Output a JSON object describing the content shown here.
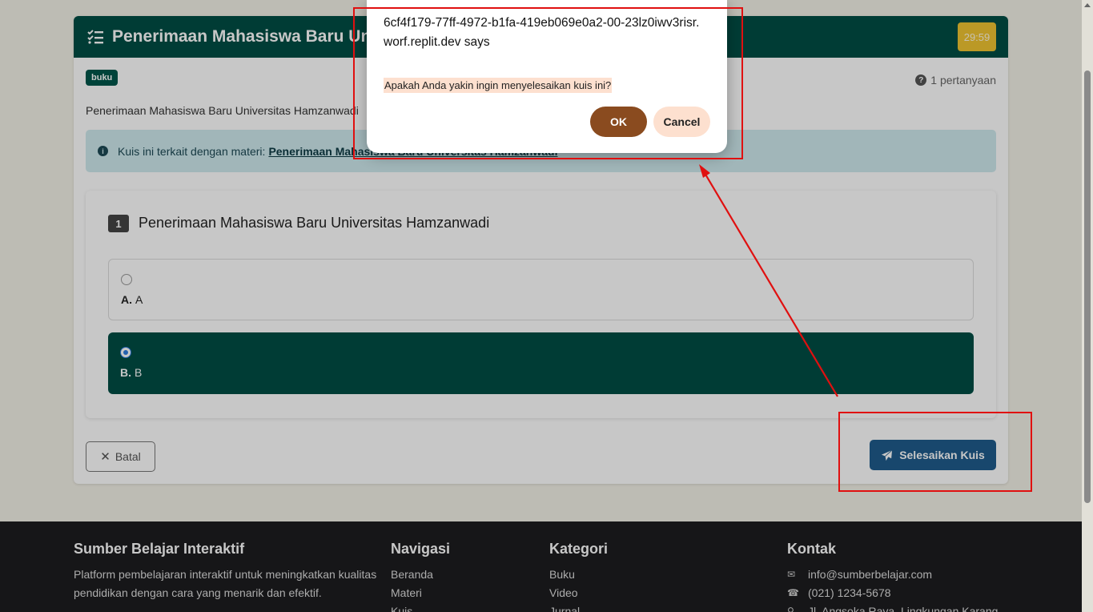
{
  "quiz": {
    "title": "Penerimaan Mahasiswa Baru Uni",
    "timer": "29:59",
    "tag": "buku",
    "question_count": "1 pertanyaan",
    "description": "Penerimaan Mahasiswa Baru Universitas Hamzanwadi",
    "info_prefix": "Kuis ini terkait dengan materi:",
    "info_link": "Penerimaan Mahasiswa Baru Universitas Hamzanwadi",
    "question": {
      "number": "1",
      "text": "Penerimaan Mahasiswa Baru Universitas Hamzanwadi",
      "options": [
        {
          "letter": "A.",
          "text": "A",
          "selected": false
        },
        {
          "letter": "B.",
          "text": "B",
          "selected": true
        }
      ]
    },
    "cancel_label": "Batal",
    "finish_label": "Selesaikan Kuis"
  },
  "footer": {
    "brand": {
      "title": "Sumber Belajar Interaktif",
      "text": "Platform pembelajaran interaktif untuk meningkatkan kualitas pendidikan dengan cara yang menarik dan efektif."
    },
    "nav": {
      "title": "Navigasi",
      "items": [
        "Beranda",
        "Materi",
        "Kuis"
      ]
    },
    "categories": {
      "title": "Kategori",
      "items": [
        "Buku",
        "Video",
        "Jurnal"
      ]
    },
    "contact": {
      "title": "Kontak",
      "email": "info@sumberbelajar.com",
      "phone": "(021) 1234-5678",
      "address": "Jl. Angsoka Raya, Lingkungan Karang"
    }
  },
  "dialog": {
    "origin": "6cf4f179-77ff-4972-b1fa-419eb069e0a2-00-23lz0iwv3risr.worf.replit.dev says",
    "message": "Apakah Anda yakin ingin menyelesaikan kuis ini?",
    "ok_label": "OK",
    "cancel_label": "Cancel"
  },
  "colors": {
    "primary": "#004d44",
    "finish_button": "#1f5c8c",
    "annotation": "#e01010",
    "dialog_ok": "#8a4b1f",
    "dialog_cancel": "#fde0cf"
  }
}
